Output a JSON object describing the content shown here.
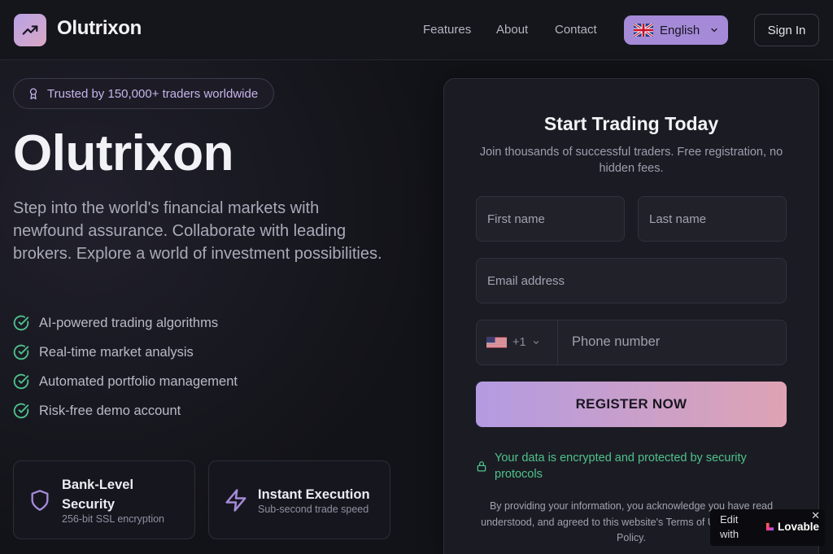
{
  "header": {
    "brand": "Olutrixon",
    "nav": [
      "Features",
      "About",
      "Contact"
    ],
    "language": "English",
    "sign_in": "Sign In"
  },
  "hero": {
    "badge": "Trusted by 150,000+ traders worldwide",
    "title": "Olutrixon",
    "subtitle": "Step into the world's financial markets with newfound assurance. Collaborate with leading brokers. Explore a world of investment possibilities.",
    "features": [
      "AI-powered trading algorithms",
      "Real-time market analysis",
      "Automated portfolio management",
      "Risk-free demo account"
    ],
    "cards": [
      {
        "title": "Bank-Level Security",
        "sub": "256-bit SSL encryption"
      },
      {
        "title": "Instant Execution",
        "sub": "Sub-second trade speed"
      }
    ]
  },
  "form": {
    "title": "Start Trading Today",
    "subtitle": "Join thousands of successful traders. Free registration, no hidden fees.",
    "first_name_placeholder": "First name",
    "last_name_placeholder": "Last name",
    "email_placeholder": "Email address",
    "country_code": "+1",
    "phone_placeholder": "Phone number",
    "submit": "REGISTER NOW",
    "secure_note": "Your data is encrypted and protected by security protocols",
    "legal": "By providing your information, you acknowledge you have read understood, and agreed to this website's Terms of Use and Privacy Policy."
  },
  "badge": {
    "edit_with": "Edit with",
    "brand": "Lovable",
    "close": "✕"
  },
  "colors": {
    "accent": "#a58ad8",
    "success": "#4fc28d",
    "background": "#121318"
  }
}
